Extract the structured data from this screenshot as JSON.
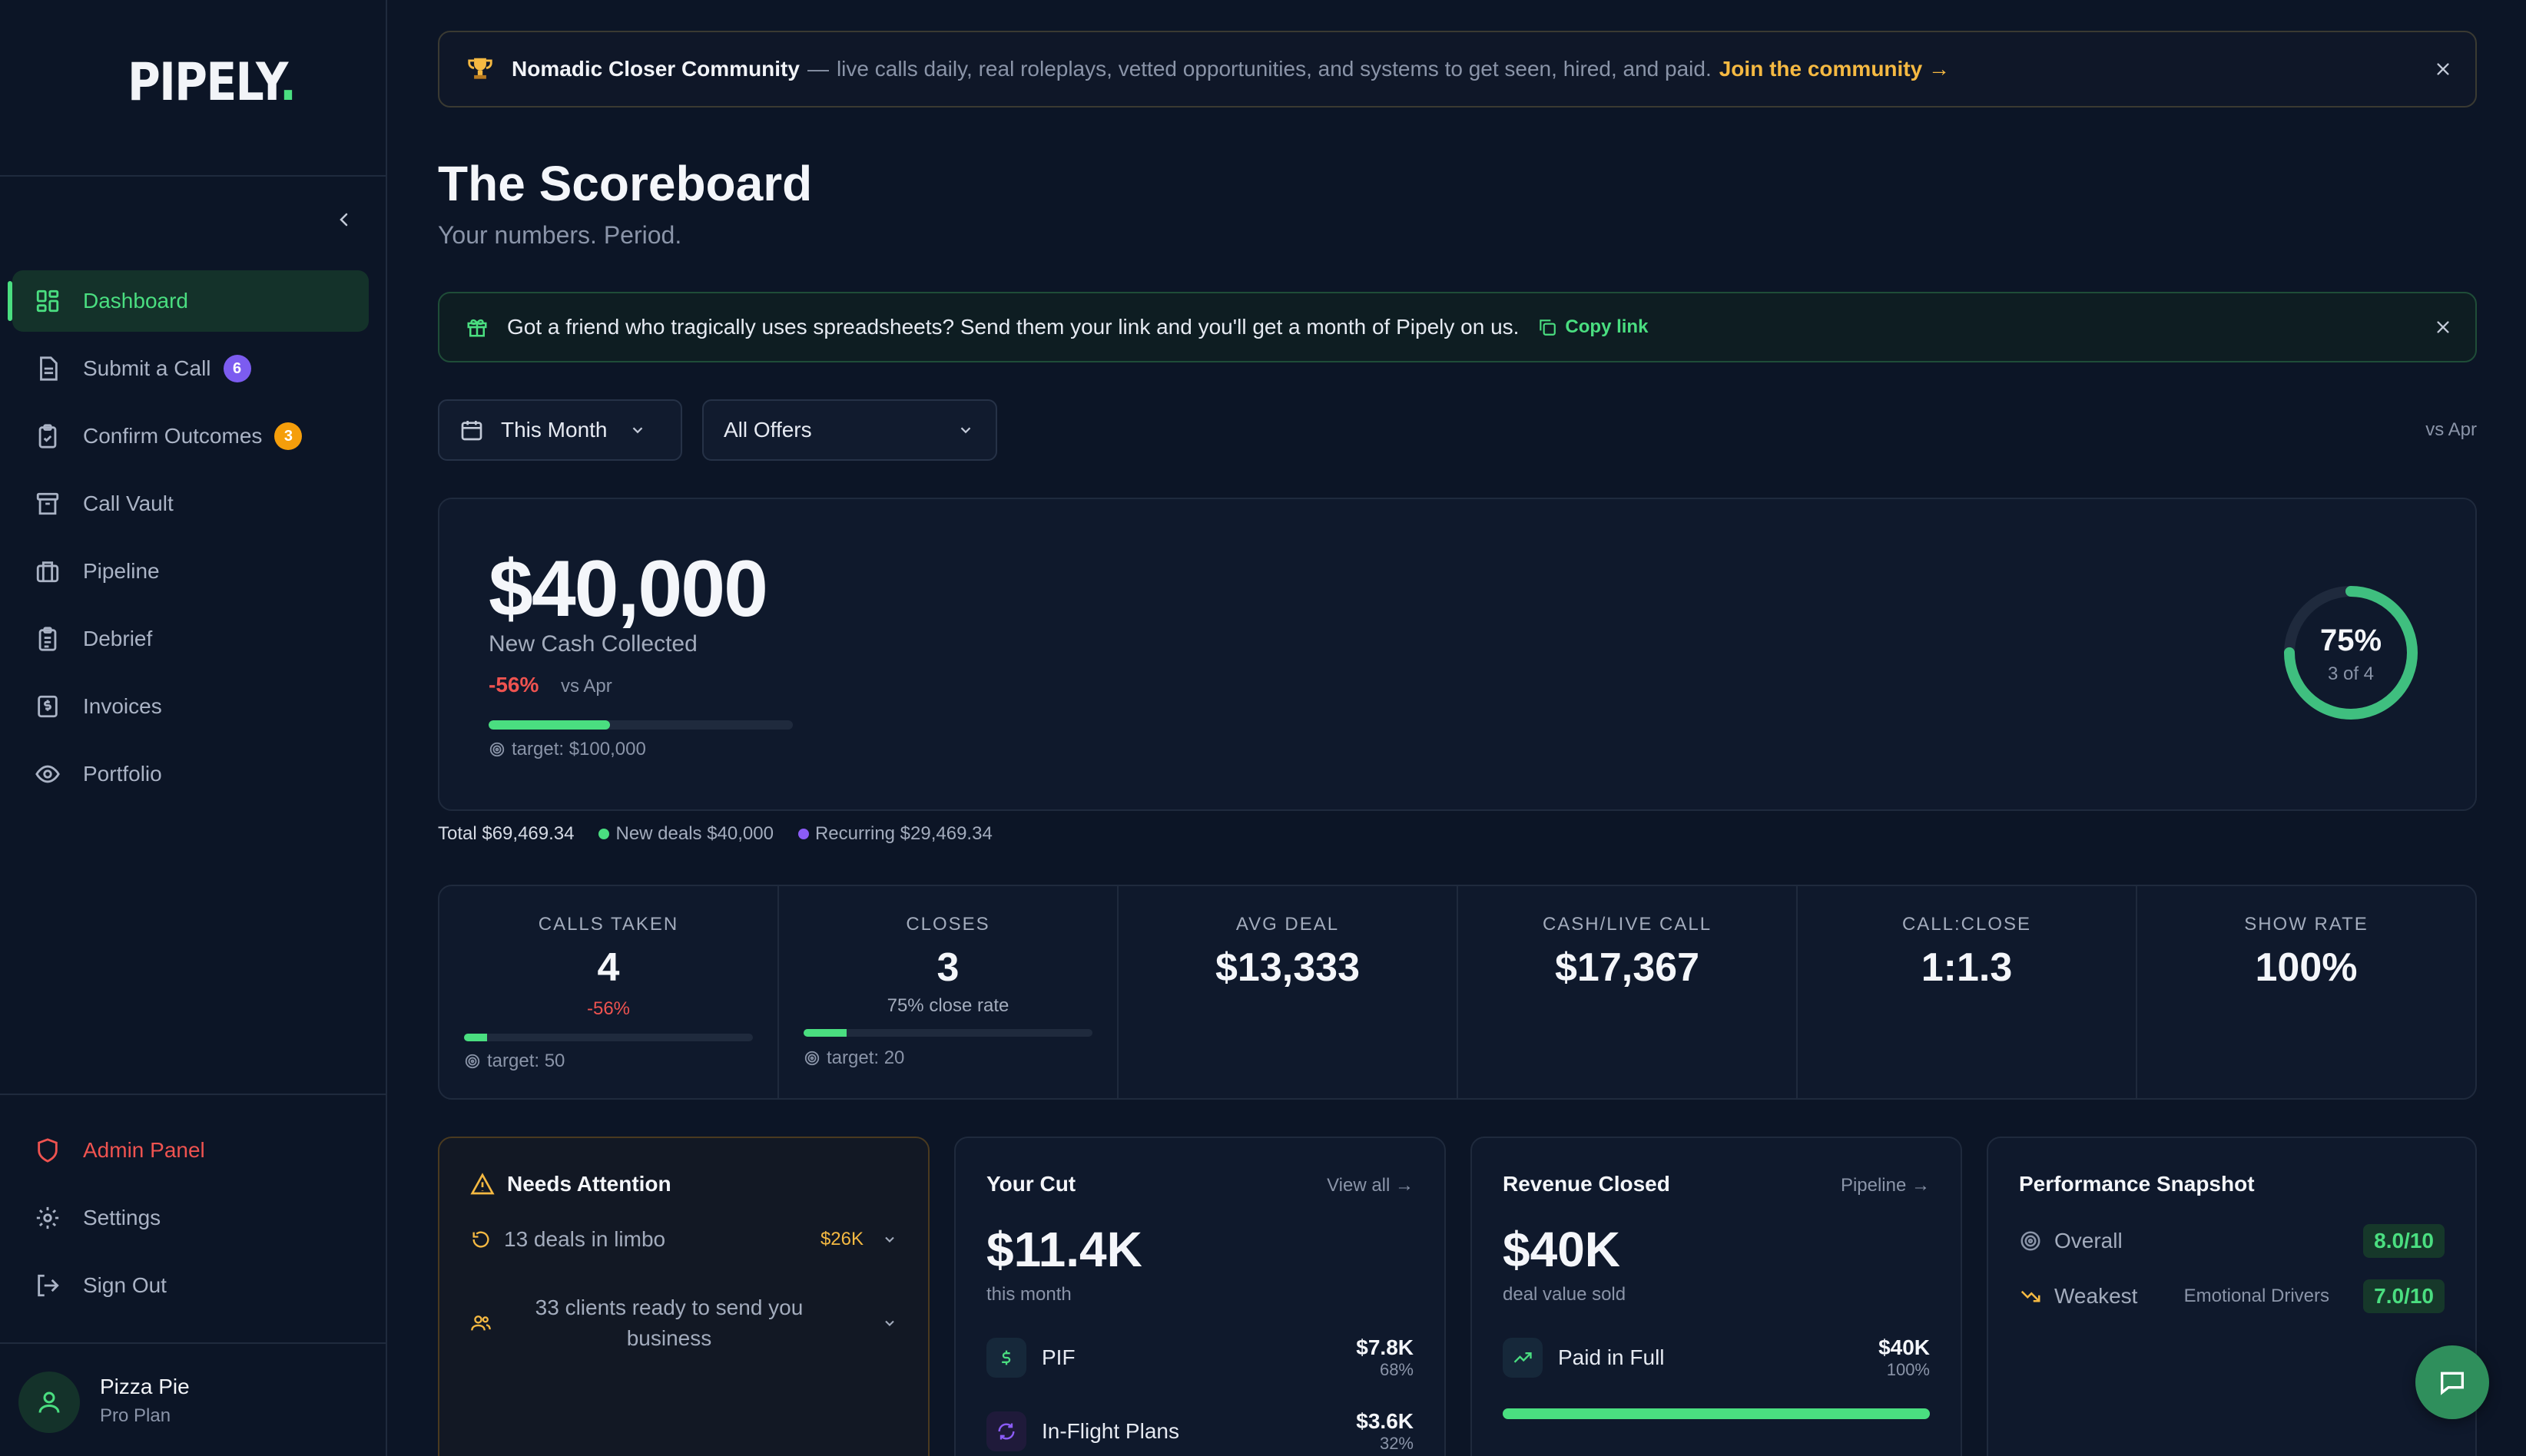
{
  "app": {
    "logo": "PIPELY",
    "logo_dot": "."
  },
  "sidebar": {
    "items": [
      {
        "label": "Dashboard",
        "icon": "grid-icon",
        "active": true
      },
      {
        "label": "Submit a Call",
        "icon": "document-icon",
        "badge": "6",
        "badge_color": "#7c5cf0"
      },
      {
        "label": "Confirm Outcomes",
        "icon": "clipboard-check-icon",
        "badge": "3",
        "badge_color": "#f59e0b"
      },
      {
        "label": "Call Vault",
        "icon": "archive-icon"
      },
      {
        "label": "Pipeline",
        "icon": "briefcase-icon"
      },
      {
        "label": "Debrief",
        "icon": "clipboard-icon"
      },
      {
        "label": "Invoices",
        "icon": "invoice-icon"
      },
      {
        "label": "Portfolio",
        "icon": "eye-icon"
      }
    ],
    "bottom": [
      {
        "label": "Admin Panel",
        "icon": "shield-icon"
      },
      {
        "label": "Settings",
        "icon": "gear-icon"
      },
      {
        "label": "Sign Out",
        "icon": "sign-out-icon"
      }
    ],
    "user": {
      "name": "Pizza Pie",
      "plan": "Pro Plan"
    }
  },
  "banner": {
    "title": "Nomadic Closer Community",
    "dash": "—",
    "text": "live calls daily, real roleplays, vetted opportunities, and systems to get seen, hired, and paid.",
    "cta": "Join the community →"
  },
  "page": {
    "title": "The Scoreboard",
    "subtitle": "Your numbers. Period."
  },
  "referral": {
    "text": "Got a friend who tragically uses spreadsheets? Send them your link and you'll get a month of Pipely on us.",
    "copy_label": "Copy link"
  },
  "filters": {
    "period": "This Month",
    "offers": "All Offers",
    "compare": "vs Apr"
  },
  "hero": {
    "amount": "$40,000",
    "label": "New Cash Collected",
    "delta": "-56%",
    "vs": "vs Apr",
    "progress": 0.4,
    "target": "target: $100,000",
    "ring_pct": "75%",
    "ring_sub": "3 of 4",
    "ring_fraction": 0.75
  },
  "totals": {
    "total": "Total $69,469.34",
    "new_deals": "New deals $40,000",
    "recurring": "Recurring $29,469.34",
    "new_color": "#4ade80",
    "recurring_color": "#8b5cf6"
  },
  "stats": [
    {
      "label": "CALLS TAKEN",
      "value": "4",
      "sub": "-56%",
      "sub_color": "#ef5350",
      "progress": 0.08,
      "target": "target: 50"
    },
    {
      "label": "CLOSES",
      "value": "3",
      "sub": "75% close rate",
      "sub_color": "#a3acbd",
      "progress": 0.15,
      "target": "target: 20"
    },
    {
      "label": "AVG DEAL",
      "value": "$13,333"
    },
    {
      "label": "CASH/LIVE CALL",
      "value": "$17,367"
    },
    {
      "label": "CALL:CLOSE",
      "value": "1:1.3"
    },
    {
      "label": "SHOW RATE",
      "value": "100%"
    }
  ],
  "attention": {
    "title": "Needs Attention",
    "limbo": "13 deals in limbo",
    "limbo_value": "$26K",
    "clients": "33 clients ready to send you business"
  },
  "your_cut": {
    "title": "Your Cut",
    "link": "View all →",
    "amount": "$11.4K",
    "sub": "this month",
    "rows": [
      {
        "label": "PIF",
        "value": "$7.8K",
        "pct": "68%"
      },
      {
        "label": "In-Flight Plans",
        "value": "$3.6K",
        "pct": "32%"
      }
    ]
  },
  "revenue": {
    "title": "Revenue Closed",
    "link": "Pipeline →",
    "amount": "$40K",
    "sub": "deal value sold",
    "row": {
      "label": "Paid in Full",
      "value": "$40K",
      "pct": "100%"
    },
    "progress": 1.0
  },
  "snapshot": {
    "title": "Performance Snapshot",
    "overall_label": "Overall",
    "overall_score": "8.0/10",
    "weakest_label": "Weakest",
    "weakest_area": "Emotional Drivers",
    "weakest_score": "7.0/10"
  }
}
